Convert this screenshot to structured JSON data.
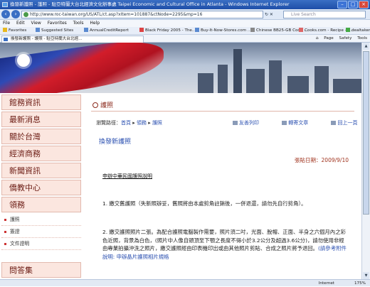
{
  "window": {
    "title": "換發新護照 - 護照 - 駐亞特蘭大台北經濟文化辦事處 Taipei Economic and Cultural Office in Atlanta - Windows Internet Explorer"
  },
  "address": {
    "url": "http://www.roc-taiwan.org/US/ATL/ct.asp?xItem=101887&ctNode=2295&mp=16",
    "search_placeholder": "Live Search"
  },
  "menu": [
    "File",
    "Edit",
    "View",
    "Favorites",
    "Tools",
    "Help"
  ],
  "favorites": {
    "label": "Favorites",
    "items": [
      "Suggested Sites",
      "AnnualCreditReport",
      "Black Friday 2005 - The...",
      "Buy-It-Now-Stores.com ...",
      "Chinese BB25-GB Code ...",
      "Cooks.com - Recipe - B...",
      "dealtaker"
    ]
  },
  "tab": {
    "label": "換發新護照 - 護照 - 駐亞特蘭大台北經...",
    "tools": [
      "Page",
      "Safety",
      "Tools"
    ]
  },
  "sidebar": {
    "items": [
      "館務資訊",
      "最新消息",
      "關於台灣",
      "經濟商務",
      "新聞資訊",
      "僑教中心",
      "領務"
    ],
    "sub_items": [
      "護照",
      "簽證",
      "文件證明"
    ],
    "bottom_item": "問答集"
  },
  "main": {
    "page_title": "護照",
    "breadcrumb_prefix": "瀏覽路徑：",
    "breadcrumb": [
      "首頁",
      "領務",
      "護照"
    ],
    "actions": [
      "友善列印",
      "轉寄文章",
      "回上一頁"
    ],
    "headline": "換發新護照",
    "date": "張貼日期：2009/9/10",
    "article_name": "申辦中華民國護照說明",
    "para1": "1. 繳交舊護照（失新照辦妥，舊照將由本處剪角註銷後，一併退還，請勿先自行剪角）。",
    "para2": "2. 繳交護照照片二張。為配合護照電腦製作需要，照片須二吋，光面、脫帽、正面、半身之六個月內之彩色近照，背景為白色，(照片中人像自頭頂至下顎之長度不得小於3.2公分及超過3.6公分)，請勿使用非經由專業拍攝沖洗之照片，繳交護照經由印表機印出或由其他照片剪貼、合成之照片將予退回。",
    "para2_link": "(請參考附件說明: 申辦晶片護照相片規格"
  },
  "status": {
    "zone": "Internet",
    "zoom": "175%"
  }
}
